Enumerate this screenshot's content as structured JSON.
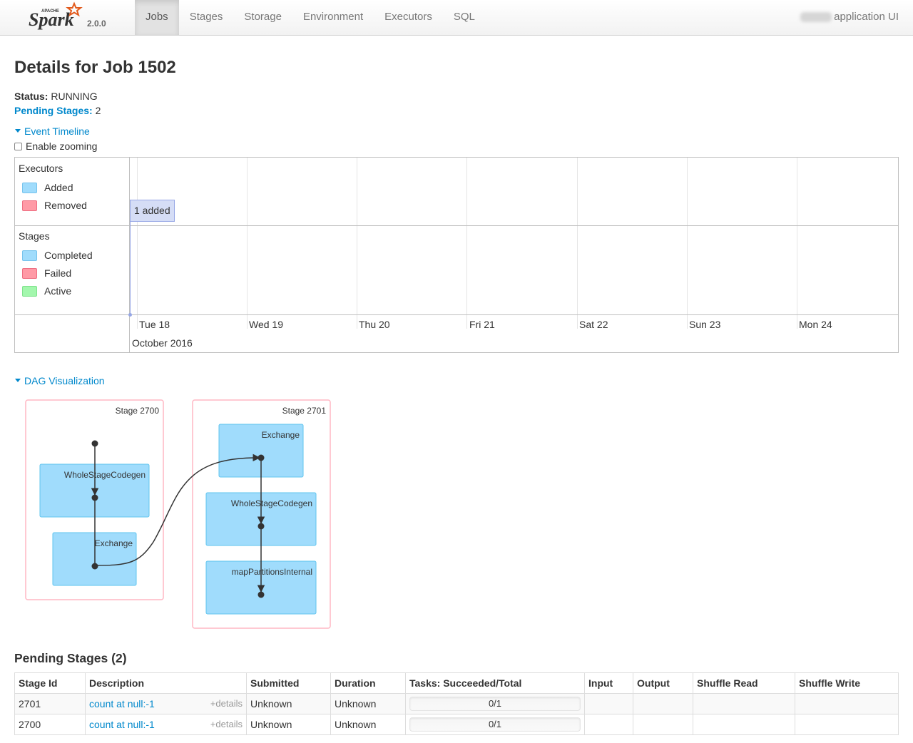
{
  "header": {
    "brand_small": "APACHE",
    "brand": "Spark",
    "version": "2.0.0",
    "tabs": [
      {
        "label": "Jobs",
        "active": true
      },
      {
        "label": "Stages",
        "active": false
      },
      {
        "label": "Storage",
        "active": false
      },
      {
        "label": "Environment",
        "active": false
      },
      {
        "label": "Executors",
        "active": false
      },
      {
        "label": "SQL",
        "active": false
      }
    ],
    "app_title": "application UI"
  },
  "page": {
    "title": "Details for Job 1502",
    "status_label": "Status:",
    "status_value": "RUNNING",
    "pending_label": "Pending Stages:",
    "pending_value": "2"
  },
  "timeline": {
    "toggle": "Event Timeline",
    "zoom_label": "Enable zooming",
    "executors": {
      "title": "Executors",
      "legend": [
        {
          "label": "Added",
          "color": "#a0dcfc"
        },
        {
          "label": "Removed",
          "color": "#ff9aa6"
        }
      ],
      "event": "1 added"
    },
    "stages": {
      "title": "Stages",
      "legend": [
        {
          "label": "Completed",
          "color": "#a0dcfc"
        },
        {
          "label": "Failed",
          "color": "#ff9aa6"
        },
        {
          "label": "Active",
          "color": "#a3f7ad"
        }
      ]
    },
    "axis_days": [
      "Tue 18",
      "Wed 19",
      "Thu 20",
      "Fri 21",
      "Sat 22",
      "Sun 23",
      "Mon 24"
    ],
    "axis_month": "October 2016"
  },
  "dag": {
    "toggle": "DAG Visualization",
    "stages": [
      {
        "label": "Stage 2700",
        "nodes": [
          "WholeStageCodegen",
          "Exchange"
        ]
      },
      {
        "label": "Stage 2701",
        "nodes": [
          "Exchange",
          "WholeStageCodegen",
          "mapPartitionsInternal"
        ]
      }
    ],
    "cluster_fill": "#a0dcfc",
    "stage_border": "#ffb7c4"
  },
  "pending_stages": {
    "title": "Pending Stages (2)",
    "columns": [
      "Stage Id",
      "Description",
      "Submitted",
      "Duration",
      "Tasks: Succeeded/Total",
      "Input",
      "Output",
      "Shuffle Read",
      "Shuffle Write"
    ],
    "details_label": "+details",
    "rows": [
      {
        "stage_id": "2701",
        "description": "count at null:-1",
        "submitted": "Unknown",
        "duration": "Unknown",
        "tasks": "0/1",
        "input": "",
        "output": "",
        "shuffle_read": "",
        "shuffle_write": ""
      },
      {
        "stage_id": "2700",
        "description": "count at null:-1",
        "submitted": "Unknown",
        "duration": "Unknown",
        "tasks": "0/1",
        "input": "",
        "output": "",
        "shuffle_read": "",
        "shuffle_write": ""
      }
    ]
  }
}
